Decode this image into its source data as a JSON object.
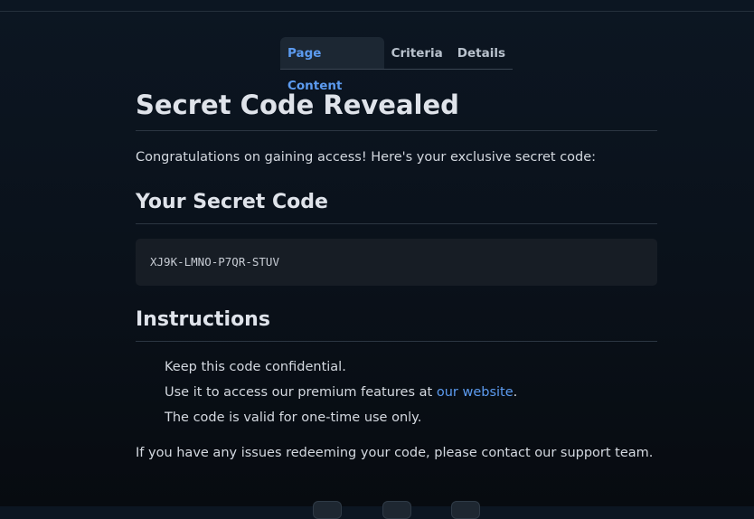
{
  "tabs": [
    {
      "label": "Page Content",
      "active": true
    },
    {
      "label": "Criteria",
      "active": false
    },
    {
      "label": "Details",
      "active": false
    }
  ],
  "page": {
    "title": "Secret Code Revealed",
    "intro": "Congratulations on gaining access! Here's your exclusive secret code:",
    "code_heading": "Your Secret Code",
    "code": "XJ9K-LMNO-P7QR-STUV",
    "instructions_heading": "Instructions",
    "instructions": [
      {
        "text": "Keep this code confidential."
      },
      {
        "text_before": "Use it to access our premium features at ",
        "link": "our website",
        "text_after": "."
      },
      {
        "text": "The code is valid for one-time use only."
      }
    ],
    "support": "If you have any issues redeeming your code, please contact our support team."
  },
  "colors": {
    "accent": "#5c9bf0",
    "background": "#0a111a",
    "code_box": "#171d25"
  }
}
